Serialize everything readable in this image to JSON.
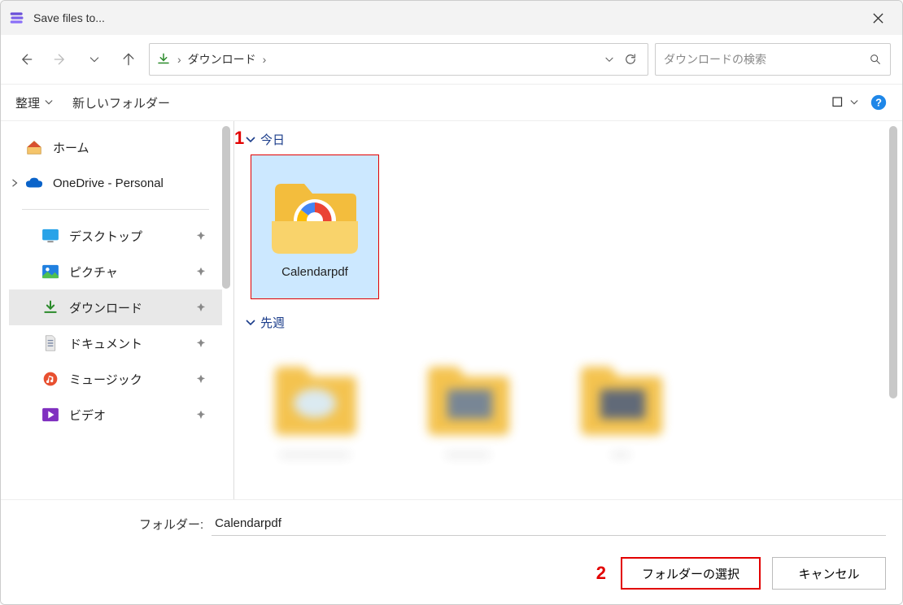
{
  "window": {
    "title": "Save files to..."
  },
  "breadcrumb": {
    "current": "ダウンロード"
  },
  "search": {
    "placeholder": "ダウンロードの検索"
  },
  "toolbar": {
    "organize": "整理",
    "new_folder": "新しいフォルダー"
  },
  "sidebar": {
    "home": "ホーム",
    "onedrive": "OneDrive - Personal",
    "desktop": "デスクトップ",
    "pictures": "ピクチャ",
    "downloads": "ダウンロード",
    "documents": "ドキュメント",
    "music": "ミュージック",
    "videos": "ビデオ"
  },
  "groups": {
    "today": "今日",
    "last_week": "先週"
  },
  "items": {
    "selected": "Calendarpdf"
  },
  "annotations": {
    "one": "1",
    "two": "2"
  },
  "footer": {
    "folder_label": "フォルダー:",
    "folder_value": "Calendarpdf",
    "select_btn": "フォルダーの選択",
    "cancel_btn": "キャンセル"
  }
}
